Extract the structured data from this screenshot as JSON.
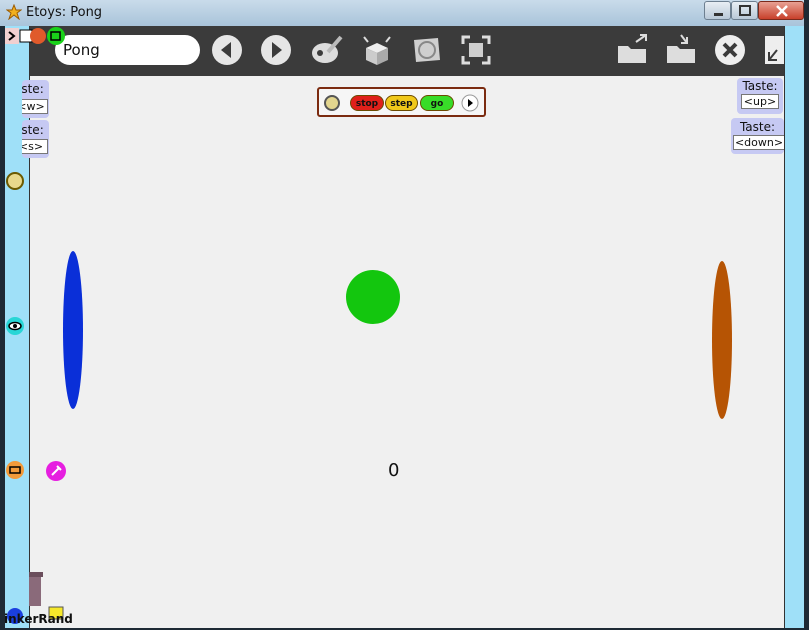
{
  "window": {
    "title": "Etoys: Pong"
  },
  "toolbar": {
    "project_name": "Pong",
    "icons": [
      "back-arrow-icon",
      "forward-arrow-icon",
      "paint-icon",
      "supplies-icon",
      "language-globe-icon",
      "fullscreen-icon",
      "load-project-icon",
      "save-project-icon",
      "quit-icon",
      "shrink-icon"
    ]
  },
  "world": {
    "score": "0",
    "controls": {
      "stop_label": "stop",
      "step_label": "step",
      "go_label": "go"
    },
    "left_tastes": [
      {
        "label": "aste:",
        "value": "<w>"
      },
      {
        "label": "aste:",
        "value": "<s>"
      }
    ],
    "right_tastes": [
      {
        "label": "Taste:",
        "value": "<up>"
      },
      {
        "label": "Taste:",
        "value": "<down>"
      }
    ],
    "bottom_label": "inkerRand",
    "colors": {
      "left_paddle": "#0a2fd8",
      "right_paddle": "#b65404",
      "ball": "#13c60e",
      "background": "#f0f0f0"
    }
  }
}
